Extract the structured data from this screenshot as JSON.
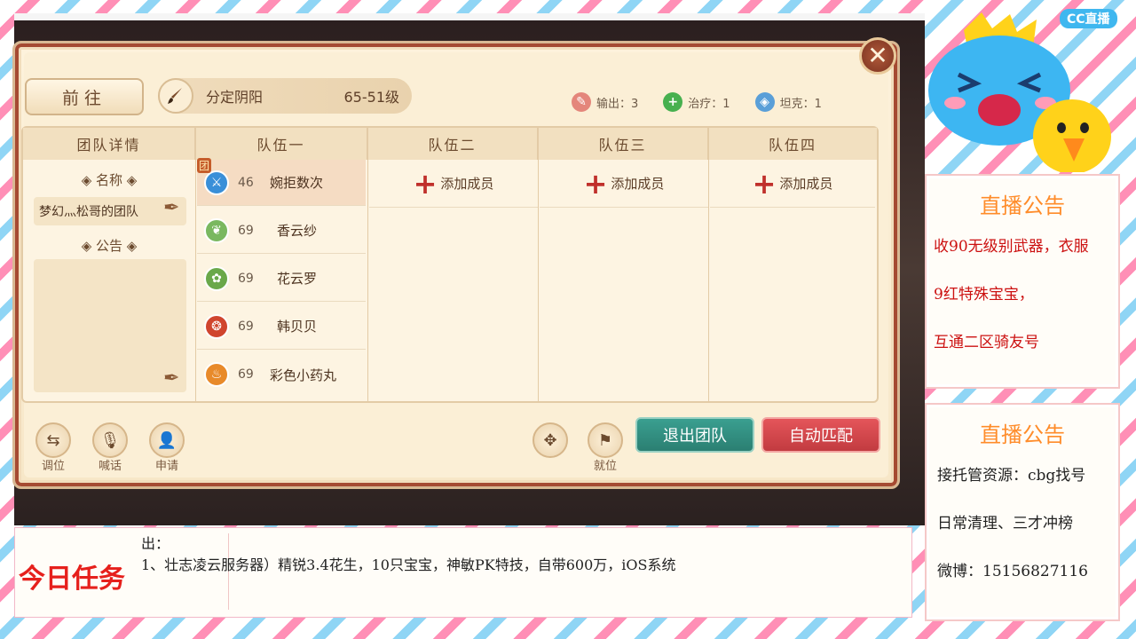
{
  "header": {
    "goto_label": "前往",
    "activity_name": "分定阴阳",
    "activity_level": "65-51级",
    "close_glyph": "✕"
  },
  "roles": {
    "dps": "输出：3",
    "healer": "治疗：1",
    "tank": "坦克：1"
  },
  "panel": {
    "detail_header": "团队详情",
    "name_label": "◈ 名称 ◈",
    "team_name": "梦幻灬松哥的团队",
    "notice_label": "◈ 公告 ◈",
    "columns": [
      "队伍一",
      "队伍二",
      "队伍三",
      "队伍四"
    ],
    "leader_badge": "团",
    "members": [
      {
        "level": "46",
        "name": "婉拒数次",
        "icon": "sword-school-icon",
        "color": "#3a8fd8"
      },
      {
        "level": "69",
        "name": "香云纱",
        "icon": "leaf-school-icon",
        "color": "#7ab860"
      },
      {
        "level": "69",
        "name": "花云罗",
        "icon": "flower-school-icon",
        "color": "#6aa84a"
      },
      {
        "level": "69",
        "name": "韩贝贝",
        "icon": "beast-school-icon",
        "color": "#d0452e"
      },
      {
        "level": "69",
        "name": "彩色小药丸",
        "icon": "flame-school-icon",
        "color": "#e88a2a"
      }
    ],
    "add_member_label": "添加成员"
  },
  "footer": {
    "swap_label": "调位",
    "shout_label": "喊话",
    "apply_label": "申请",
    "ready_label": "就位",
    "leave_label": "退出团队",
    "match_label": "自动匹配"
  },
  "sidebar": {
    "brand": "CC直播",
    "notice1": {
      "title": "直播公告",
      "lines": [
        "收90无级别武器，衣服",
        "9红特殊宝宝，",
        "互通二区骑友号"
      ]
    },
    "notice2": {
      "title": "直播公告",
      "lines": [
        "接托管资源：cbg找号",
        "日常清理、三才冲榜",
        "微博：15156827116"
      ]
    }
  },
  "task": {
    "title": "今日任务",
    "line1": "出：",
    "line2": "1、壮志凌云服务器）精锐3.4花生，10只宝宝，神敏PK特技，自带600万，iOS系统"
  }
}
